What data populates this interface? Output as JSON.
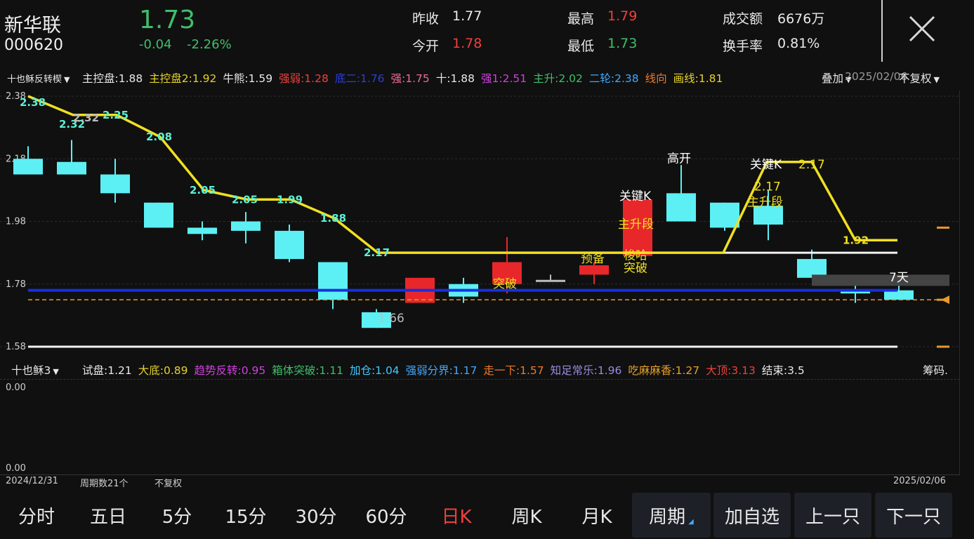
{
  "header": {
    "name": "新华联",
    "code": "000620",
    "price": "1.73",
    "change": "-0.04",
    "change_pct": "-2.26%",
    "prev_close_label": "昨收",
    "prev_close": "1.77",
    "open_label": "今开",
    "open": "1.78",
    "high_label": "最高",
    "high": "1.79",
    "low_label": "最低",
    "low": "1.73",
    "amount_label": "成交额",
    "amount": "6676万",
    "turnover_label": "换手率",
    "turnover": "0.81%",
    "close_icon": "close-icon"
  },
  "indicator_main": {
    "name": "十也稣反转楔",
    "items": [
      {
        "label": "主控盘:",
        "value": "1.88",
        "color": "#e8e8e8"
      },
      {
        "label": "主控盘2:",
        "value": "1.92",
        "color": "#e6d22a"
      },
      {
        "label": "牛熊:",
        "value": "1.59",
        "color": "#e8e8e8"
      },
      {
        "label": "强弱:",
        "value": "1.28",
        "color": "#f0403c"
      },
      {
        "label": "底二:",
        "value": "1.76",
        "color": "#2b3fe0"
      },
      {
        "label": "强:",
        "value": "1.75",
        "color": "#f06a9a"
      },
      {
        "label": "十:",
        "value": "1.88",
        "color": "#e8e8e8"
      },
      {
        "label": "强1:",
        "value": "2.51",
        "color": "#d040e0"
      },
      {
        "label": "主升:",
        "value": "2.02",
        "color": "#3fbf6a"
      },
      {
        "label": "二轮:",
        "value": "2.38",
        "color": "#40a8ff"
      },
      {
        "label": "线向",
        "value": "",
        "color": "#f07a2a"
      },
      {
        "label": "画线:",
        "value": "1.81",
        "color": "#e6d22a"
      }
    ],
    "overlay_label": "叠加",
    "date_overlay": "2025/02/06",
    "adjust_label": "不复权"
  },
  "chart_main": {
    "y_ticks": [
      "2.38",
      "2.18",
      "1.98",
      "1.78",
      "1.58"
    ],
    "annotations": [
      "突破",
      "预备",
      "关键K",
      "主升段",
      "梭哈",
      "突破",
      "高开",
      "关键K",
      "2.17",
      "主升段",
      "7天",
      "1.66"
    ],
    "line_labels": [
      "2.38",
      "2.32",
      "2.32",
      "2.25",
      "2.08",
      "2.05",
      "2.05",
      "1.99",
      "1.88",
      "2.17",
      "1.92"
    ]
  },
  "chart_data": {
    "type": "candlestick",
    "x": [
      "2024/12/31",
      "d2",
      "d3",
      "d4",
      "d5",
      "d6",
      "d7",
      "d8",
      "d9",
      "d10",
      "d11",
      "d12",
      "d13",
      "d14",
      "d15",
      "d16",
      "d17",
      "d18",
      "d19",
      "d20",
      "2025/02/06"
    ],
    "ohlc": [
      [
        2.18,
        2.22,
        2.13,
        2.13
      ],
      [
        2.17,
        2.24,
        2.13,
        2.13
      ],
      [
        2.13,
        2.18,
        2.04,
        2.07
      ],
      [
        2.04,
        2.04,
        1.96,
        1.96
      ],
      [
        1.96,
        1.98,
        1.92,
        1.94
      ],
      [
        1.98,
        2.01,
        1.91,
        1.95
      ],
      [
        1.95,
        1.97,
        1.85,
        1.86
      ],
      [
        1.85,
        1.85,
        1.7,
        1.73
      ],
      [
        1.69,
        1.7,
        1.64,
        1.64
      ],
      [
        1.72,
        1.79,
        1.72,
        1.8
      ],
      [
        1.78,
        1.8,
        1.72,
        1.74
      ],
      [
        1.78,
        1.93,
        1.75,
        1.85
      ],
      [
        1.79,
        1.81,
        1.79,
        1.79
      ],
      [
        1.81,
        1.85,
        1.78,
        1.84
      ],
      [
        1.87,
        2.0,
        1.87,
        2.05
      ],
      [
        2.07,
        2.16,
        1.99,
        1.98
      ],
      [
        2.04,
        2.04,
        1.95,
        1.96
      ],
      [
        2.03,
        2.08,
        1.92,
        1.97
      ],
      [
        1.86,
        1.89,
        1.8,
        1.8
      ],
      [
        1.76,
        1.79,
        1.72,
        1.75
      ],
      [
        1.76,
        1.78,
        1.73,
        1.73
      ]
    ],
    "ylim": [
      1.56,
      2.4
    ],
    "xlabel": "",
    "ylabel": ""
  },
  "indicator_sub": {
    "name": "十也稣3",
    "items": [
      {
        "label": "试盘:",
        "value": "1.21",
        "color": "#e8e8e8"
      },
      {
        "label": "大底:",
        "value": "0.89",
        "color": "#e6d22a"
      },
      {
        "label": "趋势反转:",
        "value": "0.95",
        "color": "#d040e0"
      },
      {
        "label": "箱体突破:",
        "value": "1.11",
        "color": "#3fbf6a"
      },
      {
        "label": "加仓:",
        "value": "1.04",
        "color": "#40c8ff"
      },
      {
        "label": "强弱分界:",
        "value": "1.17",
        "color": "#40a8ff"
      },
      {
        "label": "走一下:",
        "value": "1.57",
        "color": "#f07a2a"
      },
      {
        "label": "知足常乐:",
        "value": "1.96",
        "color": "#9a8ae0"
      },
      {
        "label": "吃麻麻香:",
        "value": "1.27",
        "color": "#e6a02a"
      },
      {
        "label": "大顶:",
        "value": "3.13",
        "color": "#f0403c"
      },
      {
        "label": "结束:",
        "value": "3.5",
        "color": "#e8e8e8"
      }
    ],
    "tail": "筹码.",
    "y_top": "0.00",
    "y_bottom": "0.00"
  },
  "footer_info": {
    "start_date": "2024/12/31",
    "period_count": "周期数21个",
    "adjust": "不复权",
    "end_date": "2025/02/06"
  },
  "bottom_bar": {
    "tabs": [
      "分时",
      "五日",
      "5分",
      "15分",
      "30分",
      "60分",
      "日K",
      "周K",
      "月K"
    ],
    "active_tab": "日K",
    "period": "周期",
    "add_watch": "加自选",
    "prev": "上一只",
    "next": "下一只"
  }
}
